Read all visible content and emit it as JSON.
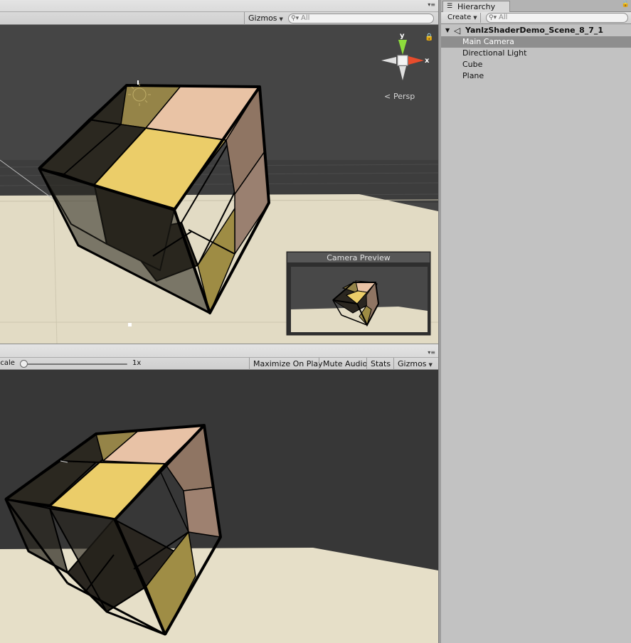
{
  "scene_view": {
    "gizmos_label": "Gizmos",
    "search_placeholder": "All",
    "persp_label": "Persp",
    "axis_y": "y",
    "axis_x": "x",
    "camera_preview_title": "Camera Preview"
  },
  "game_view": {
    "scale_label": "Scale",
    "scale_value": "1x",
    "scale_fraction": 0.0,
    "buttons": [
      "Maximize On Play",
      "Mute Audio",
      "Stats",
      "Gizmos"
    ]
  },
  "hierarchy": {
    "tab_label": "Hierarchy",
    "create_label": "Create",
    "search_placeholder": "All",
    "scene_name": "YanlzShaderDemo_Scene_8_7_1",
    "items": [
      {
        "label": "Main Camera",
        "selected": true
      },
      {
        "label": "Directional Light",
        "selected": false
      },
      {
        "label": "Cube",
        "selected": false
      },
      {
        "label": "Plane",
        "selected": false
      }
    ]
  },
  "colors": {
    "sky": "#464646",
    "floor": "#e3dcc6",
    "cube_top": "#ebcd6a",
    "cube_peach": "#e8c2a6",
    "cube_olive": "#9b8c4a",
    "cube_dark": "#2a2620",
    "selection": "#8e8e8e"
  }
}
